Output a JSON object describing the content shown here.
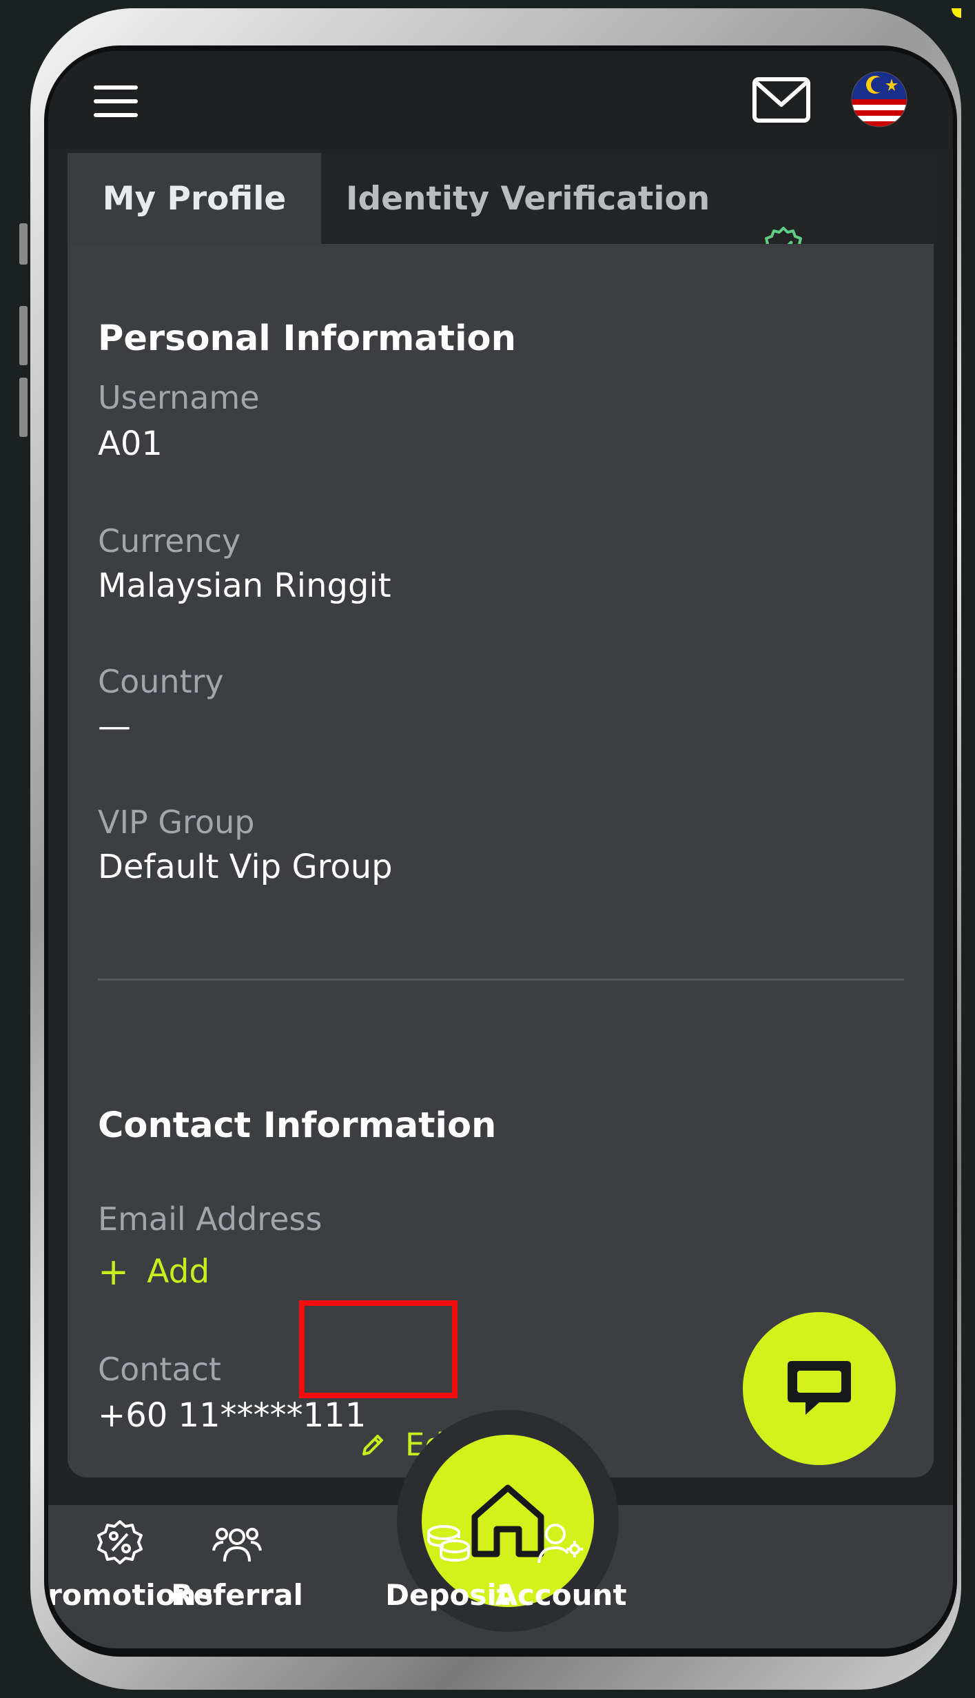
{
  "tabs": {
    "my_profile": "My Profile",
    "identity_verification": "Identity Verification"
  },
  "personal": {
    "title": "Personal Information",
    "username_label": "Username",
    "username_value": "A01",
    "currency_label": "Currency",
    "currency_value": "Malaysian Ringgit",
    "country_label": "Country",
    "country_value": "—",
    "vip_label": "VIP Group",
    "vip_value": "Default Vip Group"
  },
  "contact": {
    "title": "Contact Information",
    "email_label": "Email Address",
    "email_add": "Add",
    "contact_label": "Contact",
    "contact_value": "+60 11*****111",
    "edit_label": "Edit"
  },
  "nav": {
    "promotions": "Promotions",
    "referral": "Referral",
    "deposit": "Deposit",
    "account": "Account"
  },
  "icons": {
    "menu": "menu-icon",
    "mail": "mail-icon",
    "flag": "malaysia-flag-icon",
    "verified": "verified-badge-icon",
    "chat": "chat-icon",
    "home": "home-icon",
    "edit": "pencil-icon"
  },
  "colors": {
    "accent": "#d3f11a",
    "card": "#3c3e42",
    "verified": "#5fce84",
    "highlight": "#f20e0e"
  }
}
